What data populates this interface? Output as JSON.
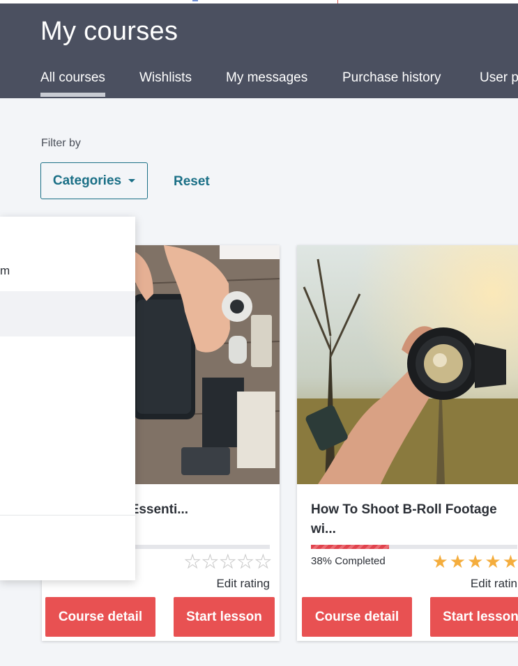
{
  "header": {
    "title": "My courses",
    "tabs": [
      {
        "label": "All courses",
        "active": true
      },
      {
        "label": "Wishlists",
        "active": false
      },
      {
        "label": "My messages",
        "active": false
      },
      {
        "label": "Purchase history",
        "active": false
      },
      {
        "label": "User p",
        "active": false
      }
    ]
  },
  "filter": {
    "label": "Filter by",
    "categories_label": "Categories",
    "reset_label": "Reset"
  },
  "dropdown": {
    "partial_item_text": "m"
  },
  "courses": [
    {
      "title": "nce Design Essenti...",
      "progress_percent": 0,
      "progress_text": "",
      "rating": 0,
      "edit_rating_label": "Edit rating",
      "course_detail_label": "Course detail",
      "start_lesson_label": "Start lesson"
    },
    {
      "title": "How To Shoot B-Roll Footage wi...",
      "progress_percent": 38,
      "progress_text": "38% Completed",
      "rating": 5,
      "edit_rating_label": "Edit ratin",
      "course_detail_label": "Course detail",
      "start_lesson_label": "Start lesson"
    }
  ],
  "colors": {
    "header_bg": "#4b5060",
    "accent_teal": "#1a6f86",
    "button_red": "#e85152",
    "star_gold": "#f4ad3d",
    "progress_red": "#e0434d"
  }
}
